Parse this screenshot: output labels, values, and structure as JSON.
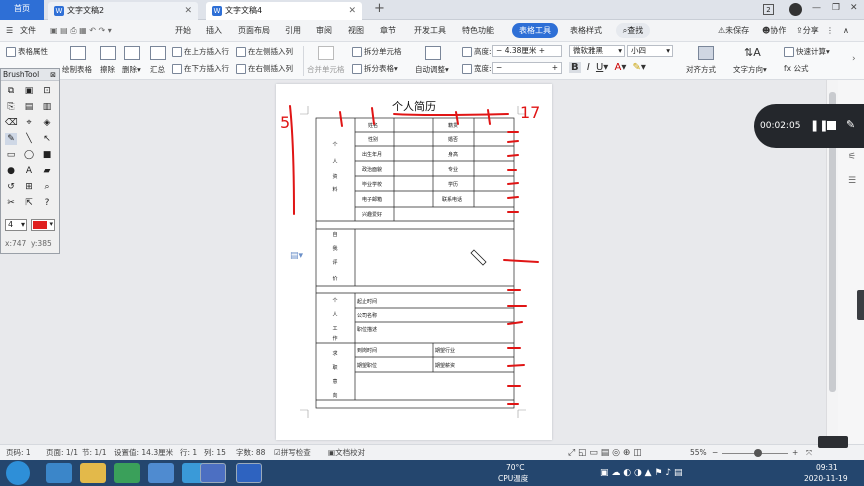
{
  "titlebar": {
    "home_tab": "首页",
    "doc_tabs": [
      "文字文稿2",
      "文字文稿4"
    ],
    "doc_icon": "W",
    "new_tab": "+",
    "badge": "2"
  },
  "menubar": {
    "file": "文件",
    "items": [
      "开始",
      "插入",
      "页面布局",
      "引用",
      "审阅",
      "视图",
      "章节",
      "开发工具",
      "特色功能"
    ],
    "active_tab": "表格工具",
    "style_tab": "表格样式",
    "search": "查找",
    "unsaved": "未保存",
    "collab": "协作",
    "share": "分享"
  },
  "ribbon": {
    "table_props": "表格属性",
    "draw_table": "绘制表格",
    "erase": "擦除",
    "delete": "删除",
    "summary": "汇总",
    "insert_above": "在上方插入行",
    "insert_below": "在下方插入行",
    "insert_left": "在左侧插入列",
    "insert_right": "在右侧插入列",
    "merge_cells": "合并单元格",
    "split_cells": "拆分单元格",
    "split_table": "拆分表格",
    "auto_fit": "自动调整",
    "height_label": "高度:",
    "height_value": "4.38厘米",
    "width_label": "宽度:",
    "width_value": "",
    "font_name": "微软雅黑",
    "font_size": "小四",
    "align": "对齐方式",
    "text_dir": "文字方向",
    "quick_calc": "快速计算",
    "formula": "公式"
  },
  "brushtool": {
    "title": "BrushTool",
    "size": "4",
    "color": "#e02020",
    "coord_x": "x:747",
    "coord_y": "y:385"
  },
  "document": {
    "title": "个人简历",
    "section_personal": [
      "个",
      "人",
      "资",
      "料"
    ],
    "section_eval": [
      "自",
      "我",
      "评",
      "价"
    ],
    "section_work": [
      "个",
      "人",
      "工",
      "作"
    ],
    "section_job": [
      "求",
      "职",
      "意",
      "向"
    ],
    "personal_left": [
      "姓名",
      "性别",
      "出生年月",
      "政治面貌",
      "毕业学校",
      "电子邮箱",
      "兴趣爱好"
    ],
    "personal_right": [
      "籍贯",
      "婚否",
      "身高",
      "专业",
      "学历",
      "联系电话"
    ],
    "work_rows": [
      "起止时间",
      "公司名称",
      "职位描述"
    ],
    "job_left": [
      "到岗时间",
      "期望职位"
    ],
    "job_right": [
      "期望行业",
      "期望薪资"
    ]
  },
  "annotations": {
    "num_left": "5",
    "num_right": "17"
  },
  "recorder": {
    "time": "00:02:05"
  },
  "statusbar": {
    "page_no": "页码: 1",
    "pages": "页面: 1/1",
    "section": "节: 1/1",
    "setting": "设置值: 14.3厘米",
    "row": "行: 1",
    "col": "列: 15",
    "words": "字数: 88",
    "spell": "拼写检查",
    "proof": "文档校对",
    "zoom": "55%"
  },
  "taskbar": {
    "temp": "70°C",
    "cpu": "CPU温度",
    "time": "09:31",
    "date": "2020-11-19",
    "start_color": "#2e8fd8",
    "annotation_color": "#e01515"
  }
}
